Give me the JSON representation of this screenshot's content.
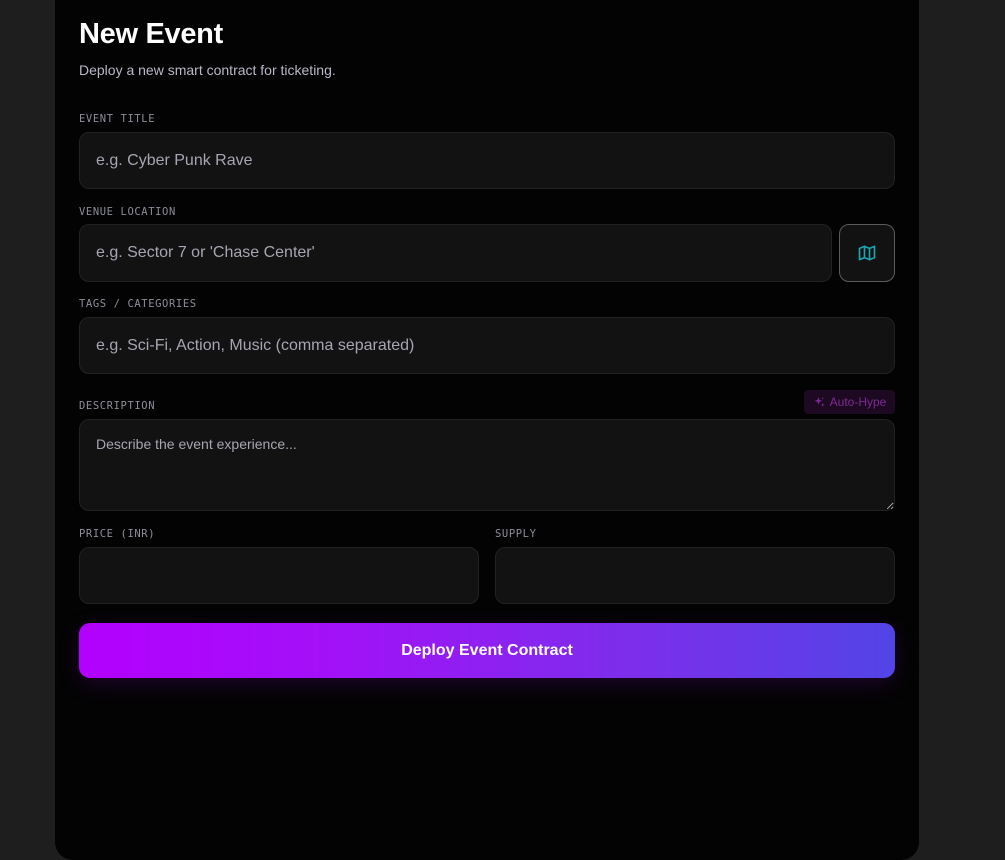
{
  "header": {
    "title": "New Event",
    "subtitle": "Deploy a new smart contract for ticketing."
  },
  "form": {
    "event_title": {
      "label": "EVENT TITLE",
      "placeholder": "e.g. Cyber Punk Rave",
      "value": ""
    },
    "venue_location": {
      "label": "VENUE LOCATION",
      "placeholder": "e.g. Sector 7 or 'Chase Center'",
      "value": "",
      "map_icon": "map-icon"
    },
    "tags": {
      "label": "TAGS / CATEGORIES",
      "placeholder": "e.g. Sci-Fi, Action, Music (comma separated)",
      "value": ""
    },
    "description": {
      "label": "DESCRIPTION",
      "placeholder": "Describe the event experience...",
      "value": "",
      "autohype_label": "Auto-Hype",
      "autohype_icon": "sparkles-icon"
    },
    "price": {
      "label": "PRICE (INR)",
      "value": ""
    },
    "supply": {
      "label": "SUPPLY",
      "value": ""
    },
    "submit_label": "Deploy Event Contract"
  },
  "colors": {
    "accent_start": "#b300ff",
    "accent_end": "#5244e6",
    "map_icon": "#1fa3b0",
    "autohype_text": "#7d2a92"
  }
}
